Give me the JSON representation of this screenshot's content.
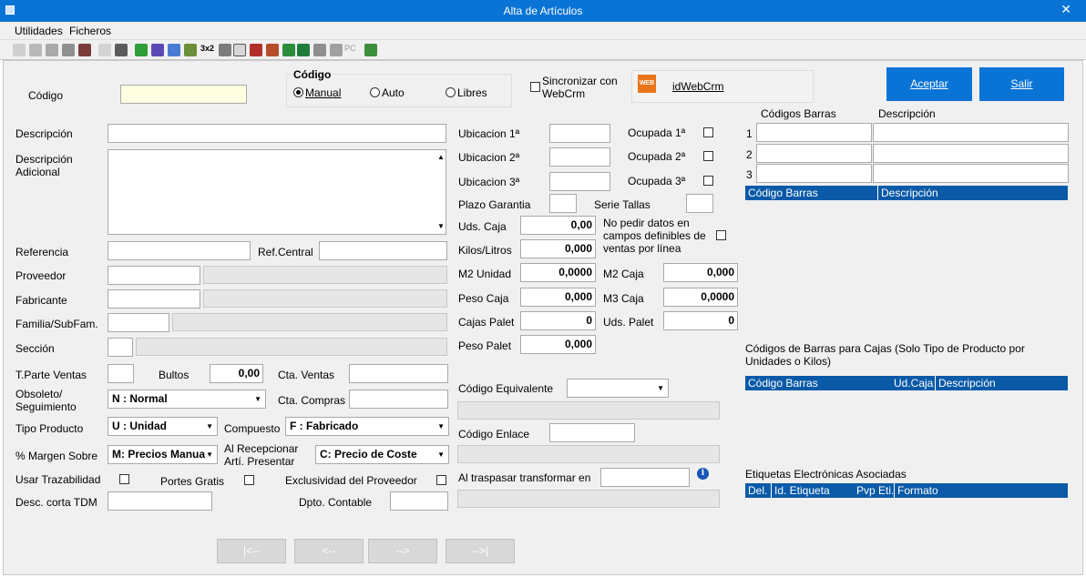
{
  "window": {
    "title": "Alta de Artículos",
    "close": "✕"
  },
  "menu": {
    "utilidades": "Utilidades",
    "ficheros": "Ficheros"
  },
  "codigo": {
    "label": "Código",
    "group_title": "Código",
    "opt_manual": "Manual",
    "opt_auto": "Auto",
    "opt_libres": "Libres",
    "selected": "Manual"
  },
  "sync": {
    "label": "Sincronizar con WebCrm",
    "badge": "WEB",
    "link": "idWebCrm"
  },
  "buttons": {
    "aceptar": "Aceptar",
    "salir": "Salir",
    "first": "|<--",
    "prev": "<--",
    "next": "-->",
    "last": "-->|"
  },
  "left": {
    "descripcion": "Descripción",
    "descripcion_adicional": "Descripción Adicional",
    "referencia": "Referencia",
    "ref_central": "Ref.Central",
    "proveedor": "Proveedor",
    "fabricante": "Fabricante",
    "familia": "Familia/SubFam.",
    "seccion": "Sección",
    "tparte": "T.Parte Ventas",
    "bultos": "Bultos",
    "bultos_value": "0,00",
    "cta_ventas": "Cta. Ventas",
    "obsoleto": "Obsoleto/ Seguimiento",
    "obsoleto_value": "N : Normal",
    "cta_compras": "Cta. Compras",
    "tipo_producto": "Tipo Producto",
    "tipo_producto_value": "U : Unidad",
    "compuesto": "Compuesto",
    "compuesto_value": "F : Fabricado",
    "margen": "% Margen Sobre",
    "margen_value": "M: Precios Manua",
    "al_recepcionar": "Al Recepcionar Artí. Presentar",
    "al_recepcionar_value": "C: Precio de Coste",
    "trazabilidad": "Usar Trazabilidad",
    "portes": "Portes Gratis",
    "exclusividad": "Exclusividad del Proveedor",
    "desc_corta": "Desc. corta TDM",
    "dpto": "Dpto. Contable"
  },
  "middle": {
    "ubicacion1": "Ubicacion 1ª",
    "ubicacion2": "Ubicacion 2ª",
    "ubicacion3": "Ubicacion 3ª",
    "ocupada1": "Ocupada 1ª",
    "ocupada2": "Ocupada 2ª",
    "ocupada3": "Ocupada 3ª",
    "plazo": "Plazo Garantia",
    "serie": "Serie Tallas",
    "uds_caja": "Uds. Caja",
    "uds_caja_value": "0,00",
    "no_pedir": "No pedir datos en campos definibles de ventas por línea",
    "kilos": "Kilos/Litros",
    "kilos_value": "0,000",
    "m2_unidad": "M2 Unidad",
    "m2_unidad_value": "0,0000",
    "m2_caja": "M2 Caja",
    "m2_caja_value": "0,000",
    "peso_caja": "Peso Caja",
    "peso_caja_value": "0,000",
    "m3_caja": "M3 Caja",
    "m3_caja_value": "0,0000",
    "cajas_palet": "Cajas Palet",
    "cajas_palet_value": "0",
    "uds_palet": "Uds. Palet",
    "uds_palet_value": "0",
    "peso_palet": "Peso Palet",
    "peso_palet_value": "0,000",
    "codigo_equivalente": "Código Equivalente",
    "codigo_enlace": "Código Enlace",
    "al_traspasar": "Al traspasar transformar en",
    "info": "i"
  },
  "right": {
    "codigos_barras": "Códigos Barras",
    "descripcion": "Descripción",
    "rows": [
      "1",
      "2",
      "3"
    ],
    "grid_h1": "Código Barras",
    "grid_h2": "Descripción",
    "cajas_title": "Códigos de Barras para Cajas  (Solo Tipo de Producto por Unidades o Kilos)",
    "cajas_h1": "Código Barras",
    "cajas_h2": "Ud.Caja",
    "cajas_h3": "Descripción",
    "etiquetas_title": "Etiquetas Electrónicas Asociadas",
    "et_h1": "Del.",
    "et_h2": "Id. Etiqueta",
    "et_h3": "Pvp Eti.",
    "et_h4": "Formato"
  }
}
